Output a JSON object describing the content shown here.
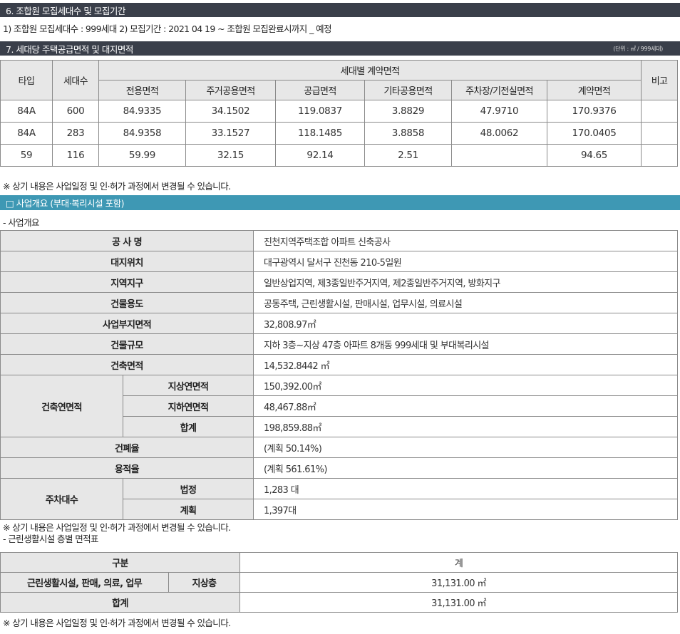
{
  "section6": {
    "title": "6. 조합원 모집세대수 및 모집기간",
    "line": "1) 조합원 모집세대수 : 999세대    2) 모집기간 : 2021 04 19 ~ 조합원 모집완료시까지  _ 예정"
  },
  "section7": {
    "title": "7. 세대당 주택공급면적 및 대지면적",
    "unit": "(단위 : ㎡ / 999세대)"
  },
  "area_table": {
    "headers": {
      "type": "타입",
      "households": "세대수",
      "contract_area_group": "세대별 계약면적",
      "note": "비고",
      "sub": [
        "전용면적",
        "주거공용면적",
        "공급면적",
        "기타공용면적",
        "주차장/기전실면적",
        "계약면적"
      ]
    },
    "rows": [
      [
        "84A",
        "600",
        "84.9335",
        "34.1502",
        "119.0837",
        "3.8829",
        "47.9710",
        "170.9376",
        ""
      ],
      [
        "84A",
        "283",
        "84.9358",
        "33.1527",
        "118.1485",
        "3.8858",
        "48.0062",
        "170.0405",
        ""
      ],
      [
        "59",
        "116",
        "59.99",
        "32.15",
        "92.14",
        "2.51",
        "",
        "94.65",
        ""
      ]
    ]
  },
  "notice": "※ 상기 내용은 사업일정 및  인·허가 과정에서 변경될 수 있습니다.",
  "overview_bar": "□ 사업개요 (부대·복리시설 포함)",
  "overview_sub": "- 사업개요",
  "overview": {
    "project_name_label": "공 사 명",
    "project_name": "진천지역주택조합 아파트 신축공사",
    "site_label": "대지위치",
    "site": "대구광역시 달서구 진천동 210-5일원",
    "zone_label": "지역지구",
    "zone": "일반상업지역, 제3종일반주거지역, 제2종일반주거지역, 방화지구",
    "use_label": "건물용도",
    "use": "공동주택, 근린생활시설, 판매시설, 업무시설, 의료시설",
    "land_area_label": "사업부지면적",
    "land_area": "32,808.97㎡",
    "scale_label": "건물규모",
    "scale": "지하 3층~지상 47층 아파트 8개동 999세대 및 부대복리시설",
    "building_area_label": "건축면적",
    "building_area": "14,532.8442 ㎡",
    "gross_label": "건축연면적",
    "gross_above_label": "지상연면적",
    "gross_above": "150,392.00㎡",
    "gross_below_label": "지하연면적",
    "gross_below": " 48,467.88㎡",
    "gross_total_label": "합계",
    "gross_total": "198,859.88㎡",
    "bcr_label": "건폐율",
    "bcr": " (계획 50.14%)",
    "far_label": "용적율",
    "far": " (계획 561.61%)",
    "parking_label": "주차대수",
    "parking_legal_label": "법정",
    "parking_legal": "1,283 대",
    "parking_plan_label": "계획",
    "parking_plan": "1,397대"
  },
  "notice2": "※ 상기 내용은 사업일정 및  인·허가 과정에서 변경될 수 있습니다.",
  "floor_sub": "- 근린생활시설 층별 면적표",
  "floor_table": {
    "col_label": "구분",
    "col_total": "계",
    "row_label": "근린생활시설, 판매, 의료, 업무",
    "row_floor": "지상층",
    "row_value": "31,131.00 ㎡",
    "sum_label": "합계",
    "sum_value": "31,131.00 ㎡"
  },
  "notice3": "※ 상기 내용은 사업일정 및  인·허가 과정에서 변경될 수 있습니다."
}
